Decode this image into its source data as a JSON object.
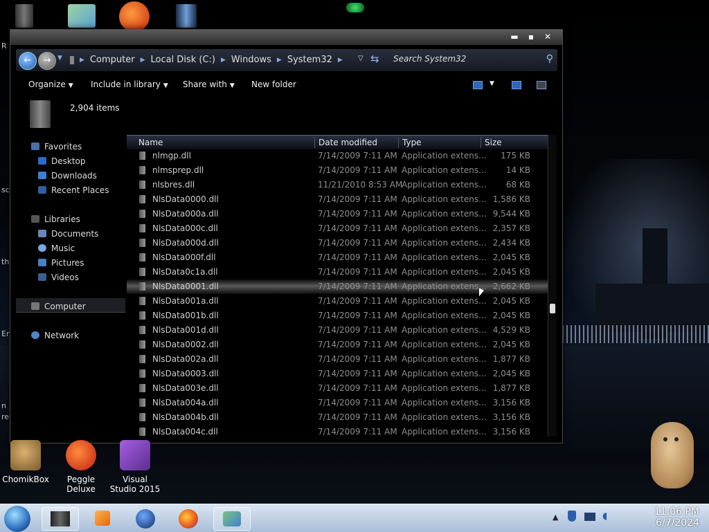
{
  "window": {
    "address": [
      "Computer",
      "Local Disk (C:)",
      "Windows",
      "System32"
    ],
    "search_placeholder": "Search System32",
    "title_buttons": [
      "minimize",
      "maximize",
      "close"
    ]
  },
  "toolbar": {
    "organize": "Organize",
    "include_in_library": "Include in library",
    "share_with": "Share with",
    "new_folder": "New folder"
  },
  "details": {
    "item_count": "2,904 items"
  },
  "navigation": {
    "favorites": {
      "label": "Favorites",
      "items": [
        "Desktop",
        "Downloads",
        "Recent Places"
      ]
    },
    "libraries": {
      "label": "Libraries",
      "items": [
        "Documents",
        "Music",
        "Pictures",
        "Videos"
      ]
    },
    "computer": "Computer",
    "network": "Network"
  },
  "file_list": {
    "columns": [
      "Name",
      "Date modified",
      "Type",
      "Size"
    ],
    "rows": [
      {
        "name": "nlmgp.dll",
        "date": "7/14/2009 7:11 AM",
        "type": "Application extens...",
        "size": "175 KB"
      },
      {
        "name": "nlmsprep.dll",
        "date": "7/14/2009 7:11 AM",
        "type": "Application extens...",
        "size": "14 KB"
      },
      {
        "name": "nlsbres.dll",
        "date": "11/21/2010 8:53 AM",
        "type": "Application extens...",
        "size": "68 KB"
      },
      {
        "name": "NlsData0000.dll",
        "date": "7/14/2009 7:11 AM",
        "type": "Application extens...",
        "size": "1,586 KB"
      },
      {
        "name": "NlsData000a.dll",
        "date": "7/14/2009 7:11 AM",
        "type": "Application extens...",
        "size": "9,544 KB"
      },
      {
        "name": "NlsData000c.dll",
        "date": "7/14/2009 7:11 AM",
        "type": "Application extens...",
        "size": "2,357 KB"
      },
      {
        "name": "NlsData000d.dll",
        "date": "7/14/2009 7:11 AM",
        "type": "Application extens...",
        "size": "2,434 KB"
      },
      {
        "name": "NlsData000f.dll",
        "date": "7/14/2009 7:11 AM",
        "type": "Application extens...",
        "size": "2,045 KB"
      },
      {
        "name": "NlsData0c1a.dll",
        "date": "7/14/2009 7:11 AM",
        "type": "Application extens...",
        "size": "2,045 KB"
      },
      {
        "name": "NlsData0001.dll",
        "date": "7/14/2009 7:11 AM",
        "type": "Application extens...",
        "size": "2,662 KB"
      },
      {
        "name": "NlsData001a.dll",
        "date": "7/14/2009 7:11 AM",
        "type": "Application extens...",
        "size": "2,045 KB"
      },
      {
        "name": "NlsData001b.dll",
        "date": "7/14/2009 7:11 AM",
        "type": "Application extens...",
        "size": "2,045 KB"
      },
      {
        "name": "NlsData001d.dll",
        "date": "7/14/2009 7:11 AM",
        "type": "Application extens...",
        "size": "4,529 KB"
      },
      {
        "name": "NlsData0002.dll",
        "date": "7/14/2009 7:11 AM",
        "type": "Application extens...",
        "size": "2,045 KB"
      },
      {
        "name": "NlsData002a.dll",
        "date": "7/14/2009 7:11 AM",
        "type": "Application extens...",
        "size": "1,877 KB"
      },
      {
        "name": "NlsData0003.dll",
        "date": "7/14/2009 7:11 AM",
        "type": "Application extens...",
        "size": "2,045 KB"
      },
      {
        "name": "NlsData003e.dll",
        "date": "7/14/2009 7:11 AM",
        "type": "Application extens...",
        "size": "1,877 KB"
      },
      {
        "name": "NlsData004a.dll",
        "date": "7/14/2009 7:11 AM",
        "type": "Application extens...",
        "size": "3,156 KB"
      },
      {
        "name": "NlsData004b.dll",
        "date": "7/14/2009 7:11 AM",
        "type": "Application extens...",
        "size": "3,156 KB"
      },
      {
        "name": "NlsData004c.dll",
        "date": "7/14/2009 7:11 AM",
        "type": "Application extens...",
        "size": "3,156 KB"
      }
    ],
    "hovered_row": "NlsData0001.dll"
  },
  "desktop_icons": [
    {
      "label": "ChomikBox",
      "icon": "chomikbox-icon"
    },
    {
      "label": "Peggle Deluxe",
      "icon": "peggle-icon"
    },
    {
      "label": "Visual Studio 2015",
      "icon": "visual-studio-icon"
    }
  ],
  "desktop_edge_text": [
    "R",
    "sc",
    "th",
    "Er",
    "n",
    "re"
  ],
  "taskbar": {
    "items": [
      "explorer-icon",
      "media-player-icon",
      "globe-icon",
      "firefox-icon",
      "network-users-icon"
    ],
    "tray_icons": [
      "show-hidden-icons",
      "shield-icon",
      "display-icon",
      "volume-icon"
    ],
    "time": "11:06 PM",
    "date": "6/7/2024"
  },
  "colors": {
    "window_bg": "#000000",
    "taskbar": "#c3d3e8",
    "address_bar": "#1c2130",
    "column_header_accent": "#5b6a86"
  }
}
